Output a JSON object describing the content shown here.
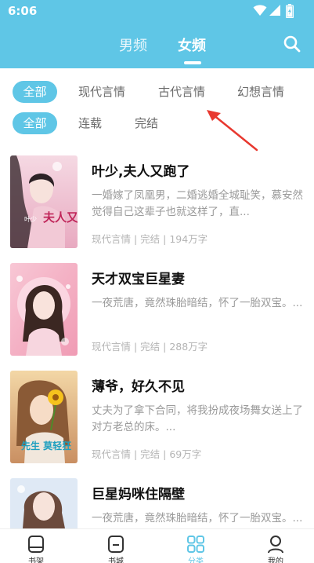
{
  "status_bar": {
    "time": "6:06"
  },
  "header": {
    "tabs": [
      {
        "label": "男频",
        "active": false
      },
      {
        "label": "女频",
        "active": true
      }
    ],
    "accent_color": "#5fc6e6"
  },
  "category_filters": [
    {
      "label": "全部",
      "active": true
    },
    {
      "label": "现代言情",
      "active": false
    },
    {
      "label": "古代言情",
      "active": false
    },
    {
      "label": "幻想言情",
      "active": false
    }
  ],
  "status_filters": [
    {
      "label": "全部",
      "active": true
    },
    {
      "label": "连载",
      "active": false
    },
    {
      "label": "完结",
      "active": false
    }
  ],
  "books": [
    {
      "title": "叶少,夫人又跑了",
      "description": "一婚嫁了凤凰男，二婚逃婚全城耻笑，慕安然觉得自己这辈子也就这样了，直...",
      "meta": "现代言情 | 完结 | 194万字",
      "cover_text": "夫人又跑了",
      "cover_tag": "叶少"
    },
    {
      "title": "天才双宝巨星妻",
      "description": "一夜荒唐，竟然珠胎暗结，怀了一胎双宝。...",
      "meta": "现代言情 | 完结 | 288万字"
    },
    {
      "title": "薄爷，好久不见",
      "description": "丈夫为了拿下合同，将我扮成夜场舞女送上了对方老总的床。...",
      "meta": "现代言情 | 完结 | 69万字",
      "cover_text": "先生 莫轻狂"
    },
    {
      "title": "巨星妈咪住隔壁",
      "description": "一夜荒唐，竟然珠胎暗结，怀了一胎双宝。...",
      "meta": ""
    }
  ],
  "bottom_nav": [
    {
      "label": "书架",
      "icon": "bookshelf-icon",
      "active": false
    },
    {
      "label": "书城",
      "icon": "bookstore-icon",
      "active": false
    },
    {
      "label": "分类",
      "icon": "category-grid-icon",
      "active": true
    },
    {
      "label": "我的",
      "icon": "profile-icon",
      "active": false
    }
  ]
}
